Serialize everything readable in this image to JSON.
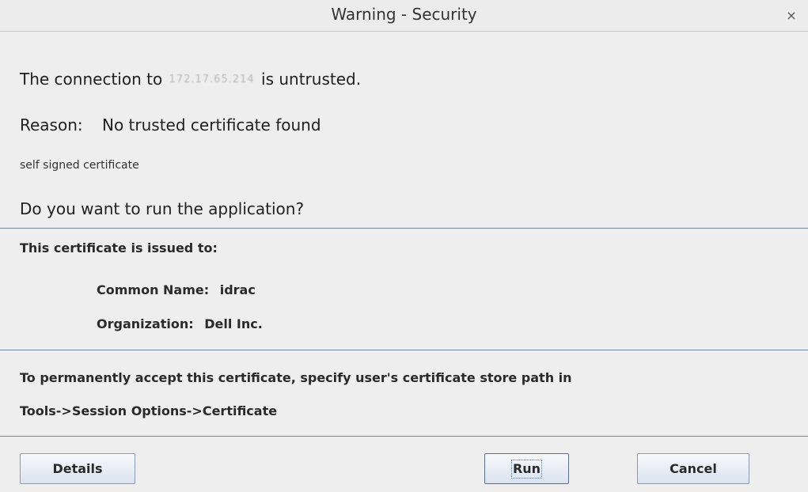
{
  "window": {
    "title": "Warning - Security",
    "close_label": "×"
  },
  "message": {
    "prefix": "The connection to",
    "host": "172.17.65.214",
    "suffix": "is untrusted."
  },
  "reason": {
    "label": "Reason:",
    "value": "No trusted certificate found"
  },
  "detail": "self signed certificate",
  "question": "Do you want to run the application?",
  "certificate": {
    "heading": "This certificate is issued to:",
    "common_name_label": "Common Name:",
    "common_name": "idrac",
    "organization_label": "Organization:",
    "organization": "Dell Inc."
  },
  "instructions": {
    "line1": "To permanently accept this certificate, specify user's certificate store path in",
    "line2": "Tools->Session Options->Certificate"
  },
  "buttons": {
    "details": "Details",
    "run": "Run",
    "cancel": "Cancel"
  },
  "colors": {
    "separator": "#6f86a8",
    "background": "#eeeeee"
  }
}
